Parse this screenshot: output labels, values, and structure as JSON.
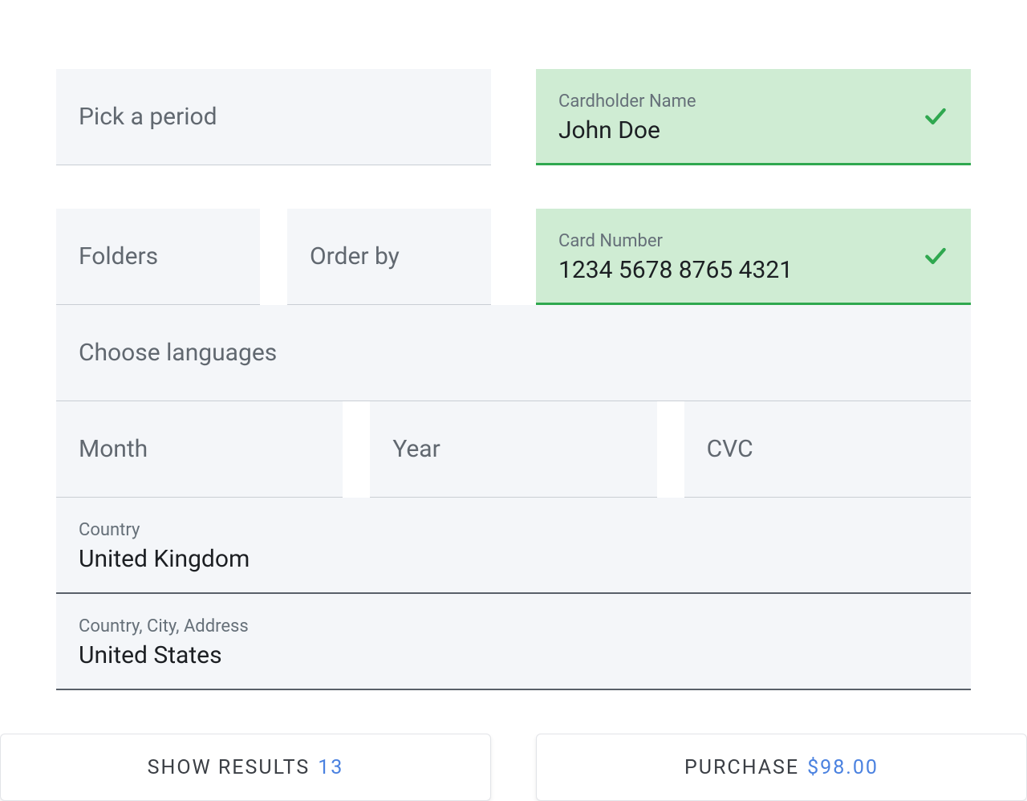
{
  "left": {
    "period": {
      "placeholder": "Pick a period"
    },
    "folders": {
      "placeholder": "Folders"
    },
    "order_by": {
      "placeholder": "Order by"
    },
    "languages": {
      "placeholder": "Choose languages"
    },
    "country": {
      "label": "Country",
      "value": "United Kingdom"
    },
    "action": {
      "label": "SHOW RESULTS",
      "count": "13"
    }
  },
  "right": {
    "cardholder": {
      "label": "Cardholder Name",
      "value": "John Doe"
    },
    "cardnumber": {
      "label": "Card Number",
      "value": "1234 5678 8765 4321"
    },
    "month": {
      "placeholder": "Month"
    },
    "year": {
      "placeholder": "Year"
    },
    "cvc": {
      "placeholder": "CVC"
    },
    "address": {
      "label": "Country, City, Address",
      "value": "United States"
    },
    "action": {
      "label": "PURCHASE",
      "amount": "$98.00"
    }
  }
}
